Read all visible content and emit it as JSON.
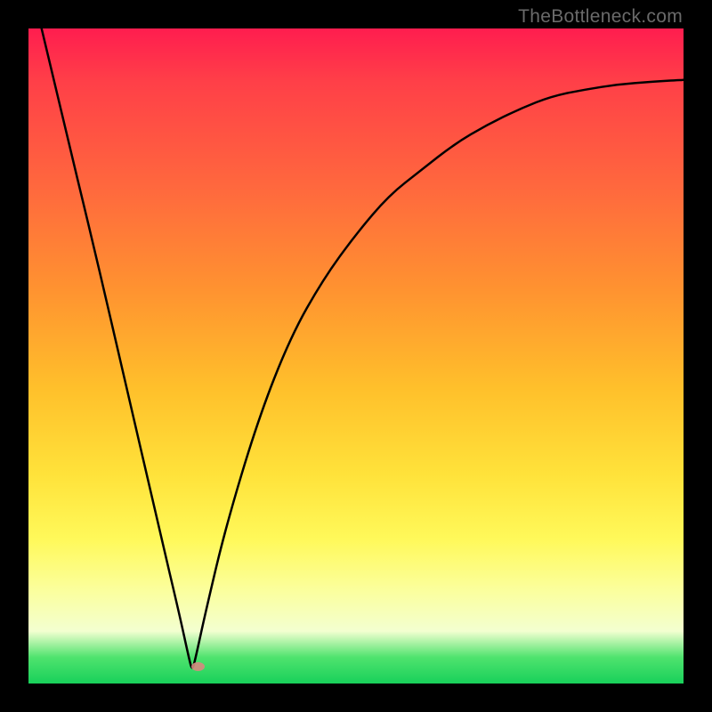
{
  "watermark": "TheBottleneck.com",
  "chart_data": {
    "type": "line",
    "title": "",
    "xlabel": "",
    "ylabel": "",
    "xlim": [
      0,
      1
    ],
    "ylim": [
      0,
      1
    ],
    "series": [
      {
        "name": "bottleneck-curve",
        "x": [
          0.02,
          0.05,
          0.1,
          0.15,
          0.2,
          0.23,
          0.245,
          0.25,
          0.255,
          0.27,
          0.3,
          0.35,
          0.4,
          0.45,
          0.5,
          0.55,
          0.6,
          0.65,
          0.7,
          0.75,
          0.8,
          0.85,
          0.9,
          0.95,
          1.0
        ],
        "y": [
          1.0,
          0.87,
          0.66,
          0.44,
          0.22,
          0.09,
          0.02,
          0.0,
          0.02,
          0.09,
          0.22,
          0.39,
          0.52,
          0.61,
          0.68,
          0.74,
          0.78,
          0.82,
          0.85,
          0.875,
          0.895,
          0.905,
          0.913,
          0.917,
          0.92
        ]
      }
    ],
    "trough": {
      "x": 0.25,
      "y": 0.0
    },
    "marker_color": "#d68a7f",
    "grid": false,
    "legend": false
  }
}
